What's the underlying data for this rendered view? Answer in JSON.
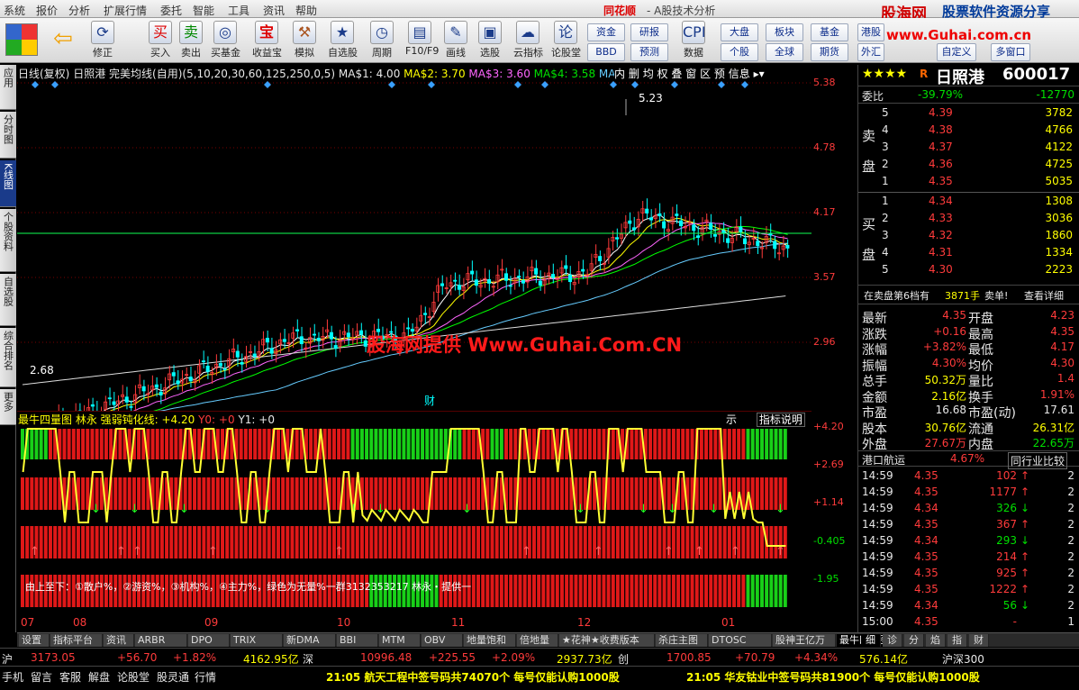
{
  "menu": [
    "系统",
    "报价",
    "分析",
    "扩展行情",
    "委托",
    "智能",
    "工具",
    "资讯",
    "帮助"
  ],
  "app_title": "同花顺",
  "window_title": "- A股技术分析",
  "toolbar": [
    "修正",
    "买入",
    "卖出",
    "买基金",
    "收益宝",
    "模拟",
    "自选股",
    "周期",
    "F10/F9",
    "画线",
    "选股",
    "云指标",
    "论股堂",
    "数据"
  ],
  "side_buttons": [
    "资金",
    "BBD",
    "研报",
    "预测",
    "大盘",
    "个股",
    "板块",
    "全球",
    "基金",
    "期货",
    "港股",
    "外汇",
    "自定义",
    "多窗口"
  ],
  "side_tabs": [
    "应用",
    "分时图",
    "K线图",
    "个股资料",
    "自选股",
    "综合排名",
    "更多"
  ],
  "chart_header": {
    "title": "日线(复权)",
    "stock": "日照港",
    "indicator": "完美均线(自用)(5,10,20,30,60,125,250,0,5)",
    "ma": [
      "MA$1: 4.00",
      "MA$2: 3.70",
      "MA$3: 3.60",
      "MA$4: 3.58",
      "MA$5: 3.3"
    ],
    "tools": [
      "内",
      "删",
      "均",
      "权",
      "叠",
      "窗",
      "区",
      "预",
      "信息"
    ]
  },
  "price_axis": [
    "5.38",
    "4.78",
    "4.17",
    "3.57",
    "2.96"
  ],
  "ind_axis": [
    "+4.20",
    "+2.69",
    "+1.14",
    "-0.405",
    "-1.95"
  ],
  "watermark": "股海网提供 Www.Guhai.Com.CN",
  "high_label": "5.23",
  "low_label": "2.68",
  "fin_label": "财",
  "ind_header": {
    "name": "最牛四量图 林永 强弱钝化线: +4.20",
    "y0": "Y0: +0",
    "y1": "Y1: +0",
    "tab1": "示",
    "tab2": "指标说明"
  },
  "ind_note": "由上至下：①散户%，②游资%，③机构%，④主力%，绿色为无量%一群3132353217 林永・提供一",
  "months": [
    "07",
    "08",
    "09",
    "10",
    "11",
    "12",
    "01"
  ],
  "brand": {
    "name": "股海网",
    "tag": "股票软件资源分享",
    "url": "www.Guhai.com.cn"
  },
  "stock": {
    "name": "日照港",
    "code": "600017",
    "stars": "★★★★",
    "r": "R"
  },
  "weibi": {
    "label": "委比",
    "pct": "-39.79%",
    "val": "-12770"
  },
  "sell": [
    {
      "n": "5",
      "p": "4.39",
      "v": "3782"
    },
    {
      "n": "4",
      "p": "4.38",
      "v": "4766"
    },
    {
      "n": "3",
      "p": "4.37",
      "v": "4122"
    },
    {
      "n": "2",
      "p": "4.36",
      "v": "4725"
    },
    {
      "n": "1",
      "p": "4.35",
      "v": "5035"
    }
  ],
  "buy": [
    {
      "n": "1",
      "p": "4.34",
      "v": "1308"
    },
    {
      "n": "2",
      "p": "4.33",
      "v": "3036"
    },
    {
      "n": "3",
      "p": "4.32",
      "v": "1860"
    },
    {
      "n": "4",
      "p": "4.31",
      "v": "1334"
    },
    {
      "n": "5",
      "p": "4.30",
      "v": "2223"
    }
  ],
  "sell_label": [
    "卖",
    "盘"
  ],
  "buy_label": [
    "买",
    "盘"
  ],
  "order_note": {
    "a": "在卖盘第6档有",
    "b": "3871手",
    "c": "卖单!",
    "d": "查看详细"
  },
  "stats": [
    [
      "最新",
      "4.35",
      "开盘",
      "4.23"
    ],
    [
      "涨跌",
      "+0.16",
      "最高",
      "4.35"
    ],
    [
      "涨幅",
      "+3.82%",
      "最低",
      "4.17"
    ],
    [
      "振幅",
      "4.30%",
      "均价",
      "4.30"
    ],
    [
      "总手",
      "50.32万",
      "量比",
      "1.4"
    ],
    [
      "金额",
      "2.16亿",
      "换手",
      "1.91%"
    ],
    [
      "市盈",
      "16.68",
      "市盈(动)",
      "17.61"
    ],
    [
      "股本",
      "30.76亿",
      "流通",
      "26.31亿"
    ],
    [
      "外盘",
      "27.67万",
      "内盘",
      "22.65万"
    ]
  ],
  "industry": {
    "name": "港口航运",
    "pct": "4.67%",
    "cmp": "同行业比较"
  },
  "ticks": [
    [
      "14:59",
      "4.35",
      "102",
      "2"
    ],
    [
      "14:59",
      "4.35",
      "1177",
      "2"
    ],
    [
      "14:59",
      "4.34",
      "326",
      "2"
    ],
    [
      "14:59",
      "4.35",
      "367",
      "2"
    ],
    [
      "14:59",
      "4.34",
      "293",
      "2"
    ],
    [
      "14:59",
      "4.35",
      "214",
      "2"
    ],
    [
      "14:59",
      "4.35",
      "925",
      "2"
    ],
    [
      "14:59",
      "4.35",
      "1222",
      "2"
    ],
    [
      "14:59",
      "4.34",
      "56",
      "2"
    ],
    [
      "15:00",
      "4.35",
      "-",
      "1"
    ]
  ],
  "bottom_tabs": [
    "设置",
    "指标平台",
    "资讯",
    "ARBR",
    "DPO",
    "TRIX",
    "新DMA",
    "BBI",
    "MTM",
    "OBV",
    "地量饱和",
    "倍地量",
    "★花神★收费版本",
    "杀庄主图",
    "DTOSC",
    "股神王亿万",
    "最牛四量图"
  ],
  "right_tabs": [
    "细",
    "诊",
    "分",
    "焰",
    "指",
    "财"
  ],
  "status": [
    [
      "沪",
      "3173.05",
      "+56.70",
      "+1.82%",
      "4162.95亿"
    ],
    [
      "深",
      "10996.48",
      "+225.55",
      "+2.09%",
      "2937.73亿"
    ],
    [
      "创",
      "1700.85",
      "+70.79",
      "+4.34%",
      "576.14亿"
    ],
    [
      "沪深300",
      ""
    ]
  ],
  "status2": [
    "手机",
    "留言",
    "客服",
    "解盘",
    "论股堂",
    "股灵通",
    "行情"
  ],
  "news": [
    "21:05 航天工程中签号码共74070个 每号仅能认购1000股",
    "21:05 华友钴业中签号码共81900个 每号仅能认购1000股"
  ],
  "colors": {
    "up": "#ff3b3b",
    "down": "#00e000",
    "ma1": "#ffffff",
    "ma2": "#ffff00",
    "ma3": "#ff66ff",
    "ma4": "#00ff00",
    "ma5": "#66ccff"
  }
}
